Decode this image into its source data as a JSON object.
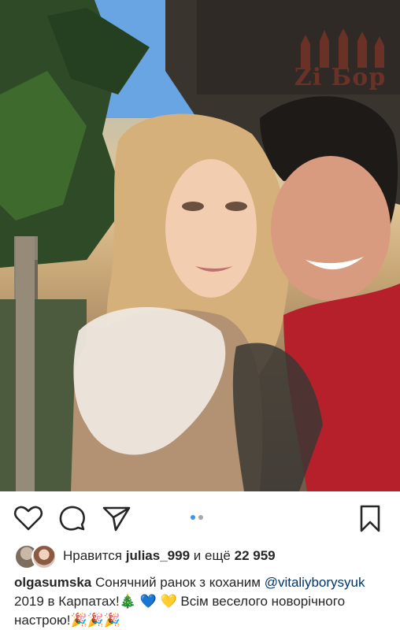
{
  "post": {
    "photo_alt": "",
    "watermark_text": "Zi Бор",
    "carousel": {
      "count": 2,
      "active": 1
    }
  },
  "actions": {
    "like_icon": "heart-icon",
    "comment_icon": "comment-icon",
    "share_icon": "paper-plane-icon",
    "save_icon": "bookmark-icon"
  },
  "likes": {
    "prefix": "Нравится",
    "user": "julias_999",
    "middle": "и ещё",
    "count": "22 959"
  },
  "caption": {
    "username": "olgasumska",
    "text_part1": "Сонячний ранок з коханим",
    "mention": "@vitaliyborysyuk",
    "text_part2": "2019 в Карпатах!",
    "emoji_tree": "🎄",
    "emoji_blue_heart": "💙",
    "emoji_yellow_heart": "💛",
    "text_part3": "Всім веселого новорічного настрою!",
    "emoji_party": "🎉🎉🎉"
  },
  "colors": {
    "link": "#003569",
    "dot_active": "#3897f0",
    "dot_inactive": "#a8a8a8",
    "watermark": "#b33a2a"
  }
}
